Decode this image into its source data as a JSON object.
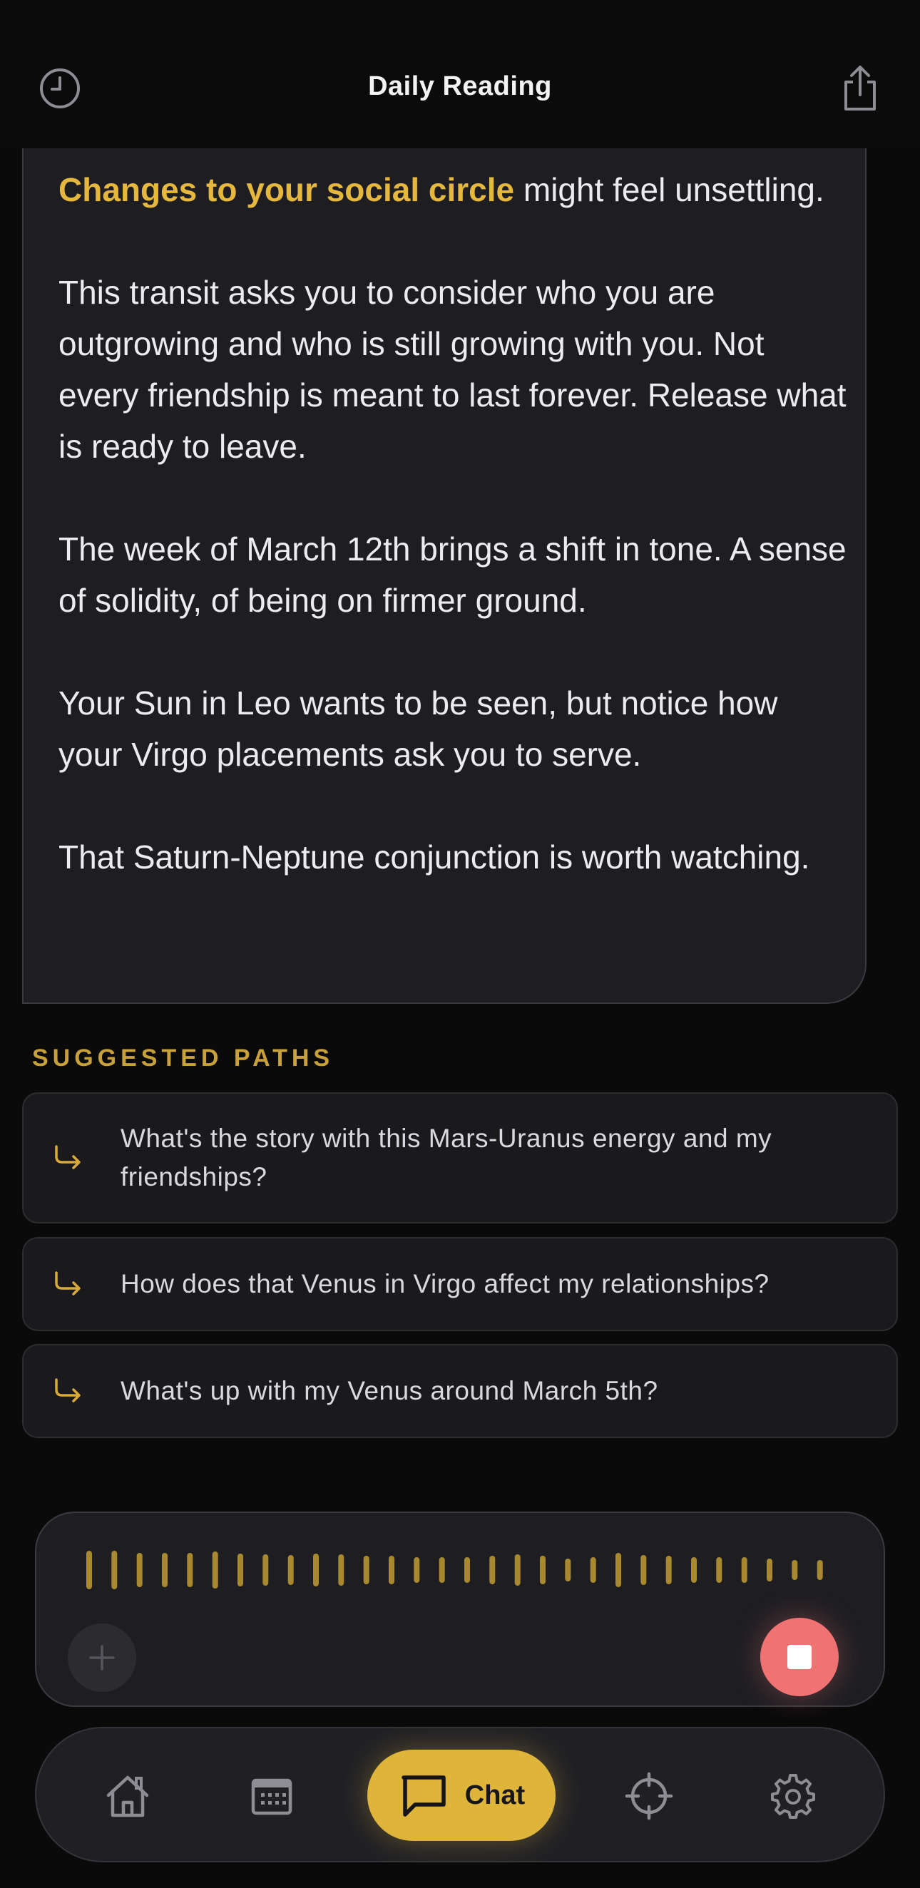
{
  "header": {
    "title": "Daily Reading"
  },
  "reading": {
    "highlight": "Changes to your social circle",
    "line1_rest": " might feel unsettling.",
    "p2": "This transit asks you to consider who you are outgrowing and who is still growing with you. Not every friendship is meant to last forever. Release what is ready to leave.",
    "p3": "The week of March 12th brings a shift in tone. A sense of solidity, of being on firmer ground.",
    "p4": "Your Sun in Leo wants to be seen, but notice how your Virgo placements ask you to serve.",
    "p5": "That Saturn-Neptune conjunction is worth watching."
  },
  "suggested": {
    "label": "SUGGESTED PATHS",
    "items": [
      {
        "text": "What's the story with this Mars-Uranus energy and my friendships?"
      },
      {
        "text": "How does that Venus in Virgo affect my relationships?"
      },
      {
        "text": "What's up with my Venus around March 5th?"
      }
    ]
  },
  "voice": {
    "state": "recording"
  },
  "nav": {
    "items": [
      "home-icon",
      "calendar-icon",
      "chat-icon",
      "crosshair-icon",
      "gear-icon"
    ],
    "chat_label": "Chat",
    "active": "Chat"
  },
  "colors": {
    "accent": "#deb43b",
    "highlight": "#e6b73d",
    "stop": "#f07272",
    "background": "#0a0a0b",
    "card": "#1d1d22"
  }
}
